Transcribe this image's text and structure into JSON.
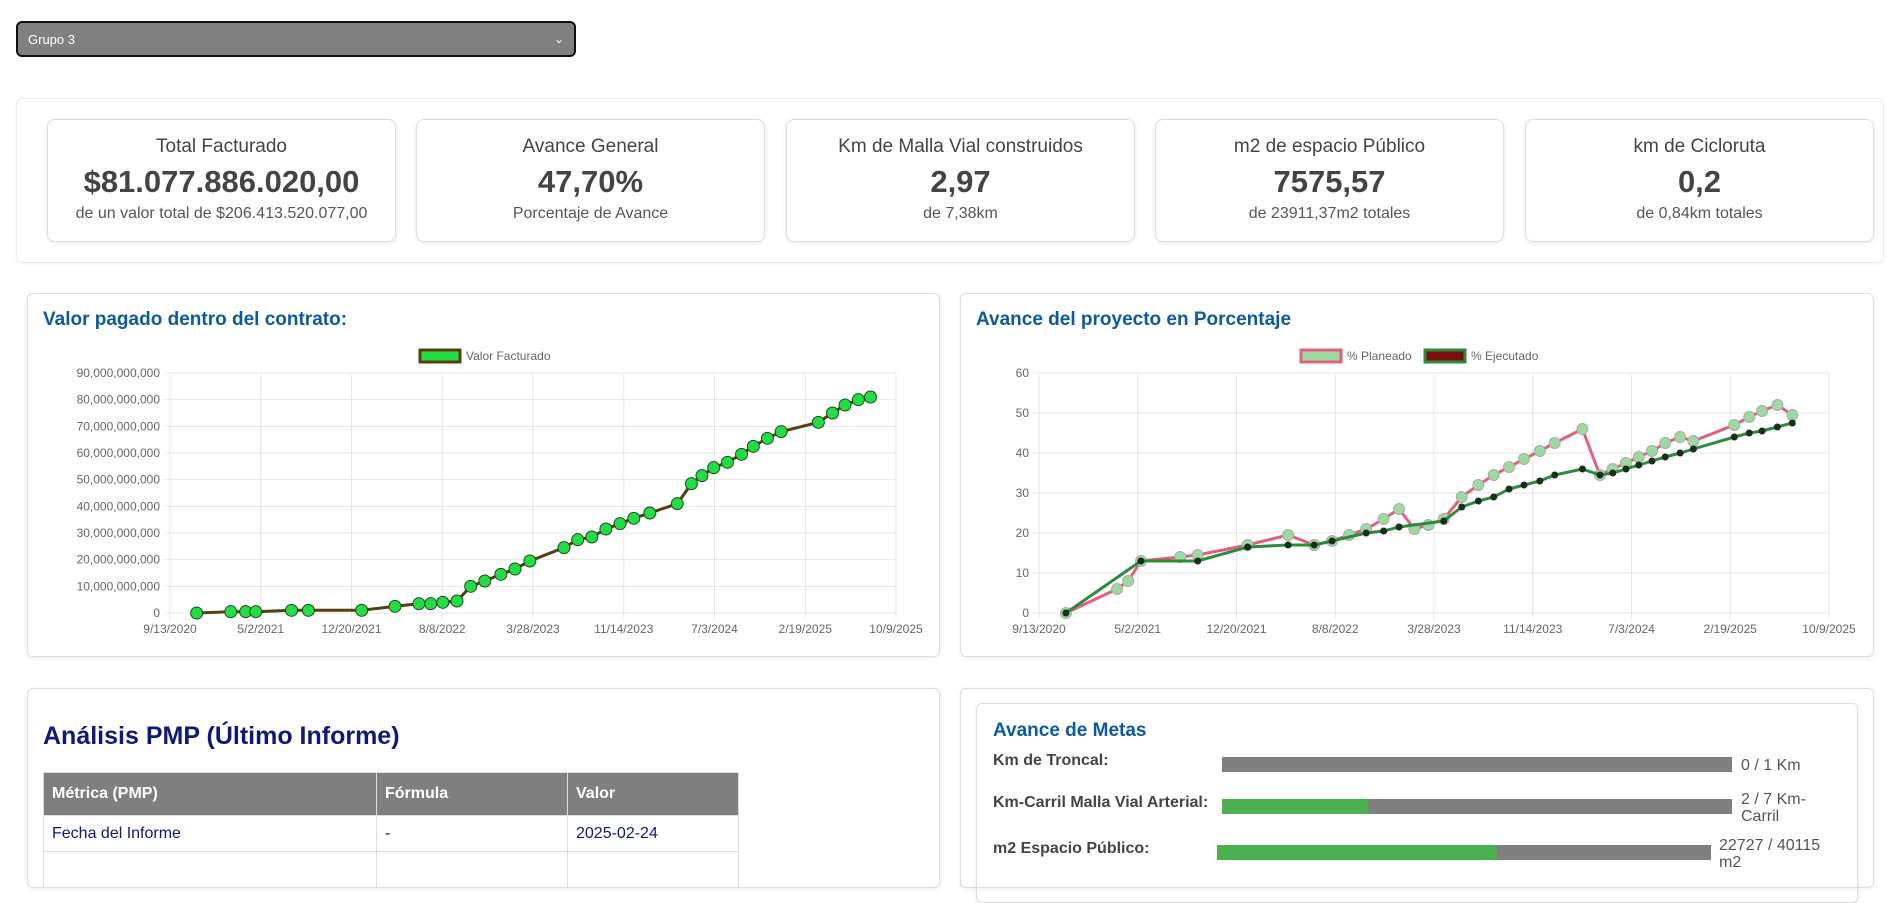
{
  "group_select": {
    "value": "Grupo 3"
  },
  "kpis": [
    {
      "title": "Total Facturado",
      "value": "$81.077.886.020,00",
      "sub": "de un valor total de $206.413.520.077,00"
    },
    {
      "title": "Avance General",
      "value": "47,70%",
      "sub": "Porcentaje de Avance"
    },
    {
      "title": "Km de Malla Vial construidos",
      "value": "2,97",
      "sub": "de 7,38km"
    },
    {
      "title": "m2 de espacio Público",
      "value": "7575,57",
      "sub": "de 23911,37m2 totales"
    },
    {
      "title": "km de Cicloruta",
      "value": "0,2",
      "sub": "de 0,84km totales"
    }
  ],
  "chart_data": [
    {
      "type": "line",
      "title": "Valor pagado dentro del contrato:",
      "x_ticks": [
        "9/13/2020",
        "5/2/2021",
        "12/20/2021",
        "8/8/2022",
        "3/28/2023",
        "11/14/2023",
        "7/3/2024",
        "2/19/2025",
        "10/9/2025"
      ],
      "y_ticks": [
        "0",
        "10,000,000,000",
        "20,000,000,000",
        "30,000,000,000",
        "40,000,000,000",
        "50,000,000,000",
        "60,000,000,000",
        "70,000,000,000",
        "80,000,000,000",
        "90,000,000,000"
      ],
      "ylim": [
        0,
        90000000000
      ],
      "xlim": [
        "2020-09-13",
        "2025-10-09"
      ],
      "grid": true,
      "legend_position": "top",
      "series": [
        {
          "name": "Valor Facturado",
          "color": "#5a3e0f",
          "point_color": "#22dd44",
          "points": [
            [
              "2020-11-20",
              0
            ],
            [
              "2021-02-15",
              500000000
            ],
            [
              "2021-03-25",
              500000000
            ],
            [
              "2021-04-20",
              500000000
            ],
            [
              "2021-07-20",
              1000000000
            ],
            [
              "2021-09-01",
              1000000000
            ],
            [
              "2022-01-15",
              1000000000
            ],
            [
              "2022-04-10",
              2500000000
            ],
            [
              "2022-06-10",
              3500000000
            ],
            [
              "2022-07-10",
              3500000000
            ],
            [
              "2022-08-10",
              4000000000
            ],
            [
              "2022-09-15",
              4500000000
            ],
            [
              "2022-10-20",
              10000000000
            ],
            [
              "2022-11-25",
              12000000000
            ],
            [
              "2023-01-05",
              14500000000
            ],
            [
              "2023-02-10",
              16500000000
            ],
            [
              "2023-03-20",
              19500000000
            ],
            [
              "2023-06-15",
              24500000000
            ],
            [
              "2023-07-20",
              27500000000
            ],
            [
              "2023-08-25",
              28500000000
            ],
            [
              "2023-09-30",
              31500000000
            ],
            [
              "2023-11-05",
              33500000000
            ],
            [
              "2023-12-10",
              35500000000
            ],
            [
              "2024-01-20",
              37500000000
            ],
            [
              "2024-03-30",
              41000000000
            ],
            [
              "2024-05-05",
              48500000000
            ],
            [
              "2024-06-01",
              51500000000
            ],
            [
              "2024-07-01",
              54500000000
            ],
            [
              "2024-08-05",
              56500000000
            ],
            [
              "2024-09-10",
              59500000000
            ],
            [
              "2024-10-10",
              62500000000
            ],
            [
              "2024-11-15",
              65500000000
            ],
            [
              "2024-12-20",
              68000000000
            ],
            [
              "2025-03-25",
              71500000000
            ],
            [
              "2025-04-30",
              75000000000
            ],
            [
              "2025-06-01",
              78000000000
            ],
            [
              "2025-07-05",
              80000000000
            ],
            [
              "2025-08-05",
              81000000000
            ]
          ]
        }
      ]
    },
    {
      "type": "line",
      "title": "Avance del proyecto en Porcentaje",
      "x_ticks": [
        "9/13/2020",
        "5/2/2021",
        "12/20/2021",
        "8/8/2022",
        "3/28/2023",
        "11/14/2023",
        "7/3/2024",
        "2/19/2025",
        "10/9/2025"
      ],
      "y_ticks": [
        "0",
        "10",
        "20",
        "30",
        "40",
        "50",
        "60"
      ],
      "ylim": [
        0,
        60
      ],
      "xlim": [
        "2020-09-13",
        "2025-10-09"
      ],
      "grid": true,
      "legend_position": "top",
      "series": [
        {
          "name": "% Planeado",
          "color": "#e0607e",
          "point_color": "#9ed99f",
          "points": [
            [
              "2020-11-15",
              0
            ],
            [
              "2021-03-15",
              6
            ],
            [
              "2021-04-10",
              8
            ],
            [
              "2021-05-10",
              13
            ],
            [
              "2021-08-10",
              14
            ],
            [
              "2021-09-20",
              14.5
            ],
            [
              "2022-01-15",
              17
            ],
            [
              "2022-04-20",
              19.5
            ],
            [
              "2022-06-20",
              17
            ],
            [
              "2022-08-01",
              18
            ],
            [
              "2022-09-10",
              19.5
            ],
            [
              "2022-10-20",
              21
            ],
            [
              "2022-11-30",
              23.5
            ],
            [
              "2023-01-05",
              26
            ],
            [
              "2023-02-10",
              21
            ],
            [
              "2023-03-15",
              22
            ],
            [
              "2023-04-20",
              23.5
            ],
            [
              "2023-06-01",
              29
            ],
            [
              "2023-07-10",
              32
            ],
            [
              "2023-08-15",
              34.5
            ],
            [
              "2023-09-20",
              36.5
            ],
            [
              "2023-10-25",
              38.5
            ],
            [
              "2023-12-01",
              40.5
            ],
            [
              "2024-01-05",
              42.5
            ],
            [
              "2024-03-10",
              46
            ],
            [
              "2024-04-20",
              34.5
            ],
            [
              "2024-05-20",
              36
            ],
            [
              "2024-06-20",
              37.5
            ],
            [
              "2024-07-20",
              39
            ],
            [
              "2024-08-20",
              40.5
            ],
            [
              "2024-09-20",
              42.5
            ],
            [
              "2024-10-25",
              44
            ],
            [
              "2024-11-25",
              43
            ],
            [
              "2025-03-01",
              47
            ],
            [
              "2025-04-05",
              49
            ],
            [
              "2025-05-05",
              50.5
            ],
            [
              "2025-06-10",
              52
            ],
            [
              "2025-07-15",
              49.5
            ]
          ]
        },
        {
          "name": "% Ejecutado",
          "color": "#2e8b3d",
          "point_color": "#1a2e1a",
          "points": [
            [
              "2020-11-15",
              0
            ],
            [
              "2021-05-10",
              13
            ],
            [
              "2021-09-20",
              13
            ],
            [
              "2022-01-15",
              16.5
            ],
            [
              "2022-04-20",
              17
            ],
            [
              "2022-06-20",
              17
            ],
            [
              "2022-08-01",
              18
            ],
            [
              "2022-10-20",
              20
            ],
            [
              "2022-11-30",
              20.5
            ],
            [
              "2023-01-05",
              21.5
            ],
            [
              "2023-04-20",
              23
            ],
            [
              "2023-06-01",
              26.5
            ],
            [
              "2023-07-10",
              28
            ],
            [
              "2023-08-15",
              29
            ],
            [
              "2023-09-20",
              31
            ],
            [
              "2023-10-25",
              32
            ],
            [
              "2023-12-01",
              33
            ],
            [
              "2024-01-05",
              34.5
            ],
            [
              "2024-03-10",
              36
            ],
            [
              "2024-04-20",
              34.5
            ],
            [
              "2024-05-20",
              35
            ],
            [
              "2024-06-20",
              36
            ],
            [
              "2024-07-20",
              37
            ],
            [
              "2024-08-20",
              38
            ],
            [
              "2024-09-20",
              39
            ],
            [
              "2024-10-25",
              40
            ],
            [
              "2024-11-25",
              41
            ],
            [
              "2025-03-01",
              44
            ],
            [
              "2025-04-05",
              45
            ],
            [
              "2025-05-05",
              45.5
            ],
            [
              "2025-06-10",
              46.5
            ],
            [
              "2025-07-15",
              47.5
            ]
          ]
        }
      ]
    }
  ],
  "pmp": {
    "title": "Análisis PMP (Último Informe)",
    "headers": [
      "Métrica (PMP)",
      "Fórmula",
      "Valor"
    ],
    "rows": [
      [
        "Fecha del Informe",
        "-",
        "2025-02-24"
      ],
      [
        "",
        "",
        ""
      ]
    ]
  },
  "metas": {
    "title": "Avance de Metas",
    "items": [
      {
        "label": "Km de Troncal:",
        "value": "0 / 1 Km",
        "progress": 0
      },
      {
        "label": "Km-Carril Malla Vial Arterial:",
        "value": "2 / 7 Km-Carril",
        "progress": 0.2857
      },
      {
        "label": "m2 Espacio Público:",
        "value": "22727 / 40115 m2",
        "progress": 0.5665
      }
    ]
  }
}
